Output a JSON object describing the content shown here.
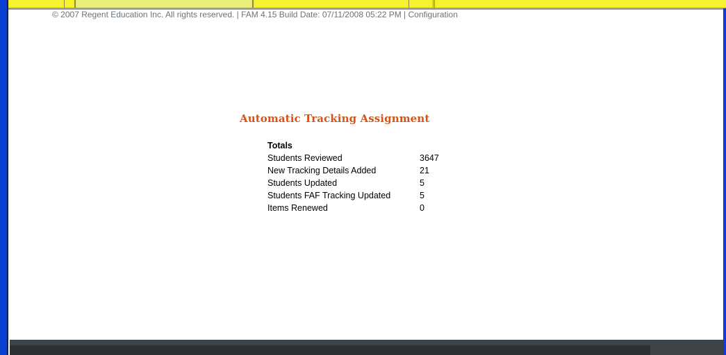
{
  "page": {
    "title": "Automatic Tracking Assignment"
  },
  "totals": {
    "heading": "Totals",
    "rows": [
      {
        "label": "Students Reviewed",
        "value": "3647"
      },
      {
        "label": "New Tracking Details Added",
        "value": "21"
      },
      {
        "label": "Students Updated",
        "value": "5"
      },
      {
        "label": "Students FAF Tracking Updated",
        "value": "5"
      },
      {
        "label": "Items Renewed",
        "value": "0"
      }
    ]
  },
  "footer": {
    "copyright": "© 2007 Regent Education Inc. All rights reserved. | FAM 4.15 Build Date: 07/11/2008 05:22 PM |",
    "config_link": "Configuration"
  },
  "colors": {
    "title": "#d4541a",
    "window_border": "#0a3fd1",
    "tab_strip": "#f7f230",
    "footer_bg": "#3d4346"
  }
}
